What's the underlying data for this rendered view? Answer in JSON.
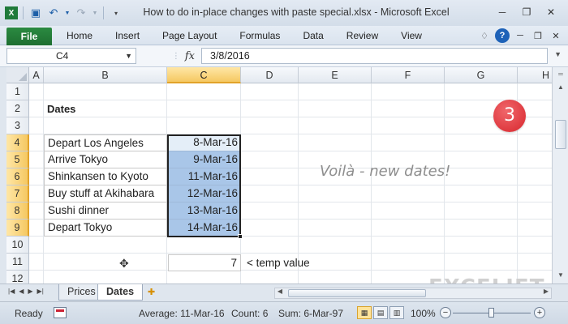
{
  "window": {
    "title": "How to do in-place changes with paste special.xlsx - Microsoft Excel"
  },
  "ribbon": {
    "file_label": "File",
    "tabs": [
      "Home",
      "Insert",
      "Page Layout",
      "Formulas",
      "Data",
      "Review",
      "View"
    ]
  },
  "formula_bar": {
    "name_box": "C4",
    "fx_label": "fx",
    "formula": "3/8/2016"
  },
  "grid": {
    "columns": [
      "A",
      "B",
      "C",
      "D",
      "E",
      "F",
      "G",
      "H"
    ],
    "rows": [
      "1",
      "2",
      "3",
      "4",
      "5",
      "6",
      "7",
      "8",
      "9",
      "10",
      "11",
      "12"
    ],
    "heading": "Dates",
    "events": [
      "Depart Los Angeles",
      "Arrive Tokyo",
      "Shinkansen to Kyoto",
      "Buy stuff at Akihabara",
      "Sushi dinner",
      "Depart Tokyo"
    ],
    "dates": [
      "8-Mar-16",
      "9-Mar-16",
      "11-Mar-16",
      "12-Mar-16",
      "13-Mar-16",
      "14-Mar-16"
    ],
    "temp_value": "7",
    "temp_label": "< temp value",
    "note": "Voilà - new dates!",
    "badge": "3"
  },
  "sheets": {
    "tabs": [
      "Prices",
      "Dates"
    ],
    "active": "Dates"
  },
  "watermark": "EXCELJET",
  "status": {
    "mode": "Ready",
    "average": "Average: 11-Mar-16",
    "count": "Count: 6",
    "sum": "Sum: 6-Mar-97",
    "zoom": "100%"
  },
  "colors": {
    "file_tab": "#2b8a41",
    "selection_fill": "#a9c6e8",
    "badge": "#d8262d",
    "header_selected": "#f5c862"
  }
}
